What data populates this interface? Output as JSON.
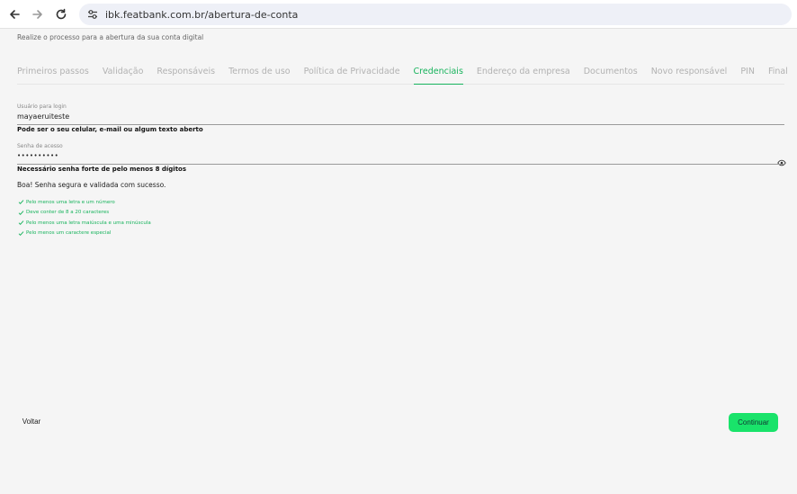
{
  "browser": {
    "url": "ibk.featbank.com.br/abertura-de-conta"
  },
  "page": {
    "subtitle": "Realize o processo para a abertura da sua conta digital"
  },
  "tabs": [
    {
      "label": "Primeiros passos",
      "active": false
    },
    {
      "label": "Validação",
      "active": false
    },
    {
      "label": "Responsáveis",
      "active": false
    },
    {
      "label": "Termos de uso",
      "active": false
    },
    {
      "label": "Política de Privacidade",
      "active": false
    },
    {
      "label": "Credenciais",
      "active": true
    },
    {
      "label": "Endereço da empresa",
      "active": false
    },
    {
      "label": "Documentos",
      "active": false
    },
    {
      "label": "Novo responsável",
      "active": false
    },
    {
      "label": "PIN",
      "active": false
    },
    {
      "label": "Final",
      "active": false
    }
  ],
  "username": {
    "label": "Usuário para login",
    "value": "mayaeruiteste",
    "hint": "Pode ser o seu celular, e-mail ou algum texto aberto"
  },
  "password": {
    "label": "Senha de acesso",
    "value": "••••••••••",
    "hint": "Necessário senha forte de pelo menos 8 dígitos",
    "success": "Boa! Senha segura e validada com sucesso."
  },
  "rules": [
    "Pelo menos uma letra e um número",
    "Deve conter de 8 a 20 caracteres",
    "Pelo menos uma letra maiúscula e uma minúscula",
    "Pelo menos um caractere especial"
  ],
  "actions": {
    "back_label": "Voltar",
    "continue_label": "Continuar"
  },
  "colors": {
    "accent": "#17b35c",
    "button": "#19e36a"
  }
}
